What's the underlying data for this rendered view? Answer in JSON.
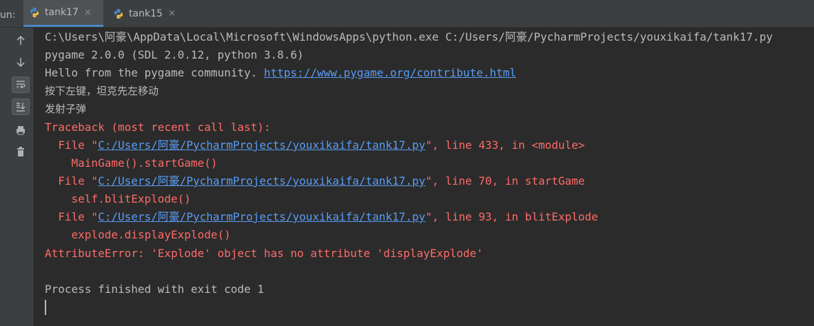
{
  "run_label": "un:",
  "tabs": [
    {
      "label": "tank17",
      "close": "×",
      "active": true
    },
    {
      "label": "tank15",
      "close": "×",
      "active": false
    }
  ],
  "toolbar_icons": [
    "up-arrow-icon",
    "down-arrow-icon",
    "soft-wrap-icon",
    "scroll-to-end-icon",
    "print-icon",
    "trash-icon"
  ],
  "console": {
    "cmd": "C:\\Users\\阿豪\\AppData\\Local\\Microsoft\\WindowsApps\\python.exe C:/Users/阿豪/PycharmProjects/youxikaifa/tank17.py",
    "pygame_version": "pygame 2.0.0 (SDL 2.0.12, python 3.8.6)",
    "hello_prefix": "Hello from the pygame community. ",
    "hello_link": "https://www.pygame.org/contribute.html",
    "msg1": "按下左键，坦克先左移动",
    "msg2": "发射子弹",
    "traceback_header": "Traceback (most recent call last):",
    "frames": [
      {
        "prefix": "  File \"",
        "path": "C:/Users/阿豪/PycharmProjects/youxikaifa/tank17.py",
        "suffix": "\", line 433, in <module>",
        "code": "    MainGame().startGame()"
      },
      {
        "prefix": "  File \"",
        "path": "C:/Users/阿豪/PycharmProjects/youxikaifa/tank17.py",
        "suffix": "\", line 70, in startGame",
        "code": "    self.blitExplode()"
      },
      {
        "prefix": "  File \"",
        "path": "C:/Users/阿豪/PycharmProjects/youxikaifa/tank17.py",
        "suffix": "\", line 93, in blitExplode",
        "code": "    explode.displayExplode()"
      }
    ],
    "error": "AttributeError: 'Explode' object has no attribute 'displayExplode'",
    "exit_message": "Process finished with exit code 1"
  },
  "colors": {
    "background": "#2b2b2b",
    "toolbar": "#3c3f41",
    "text": "#bbbbbb",
    "error": "#ff6b68",
    "link": "#589df6",
    "tab_underline": "#4a88c7"
  }
}
